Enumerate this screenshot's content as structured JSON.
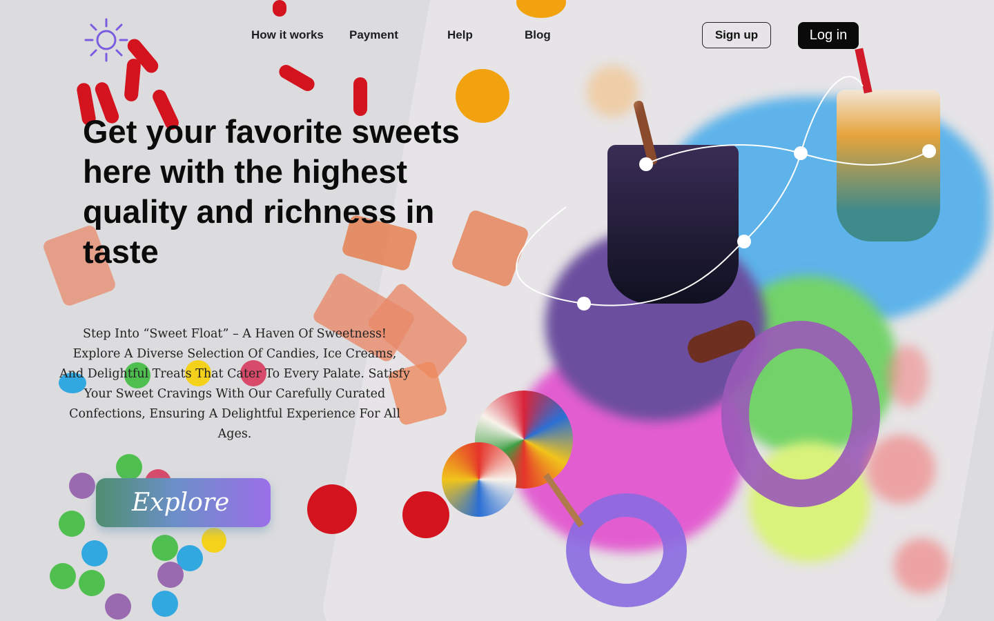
{
  "nav": {
    "how_it_works": "How it works",
    "payment": "Payment",
    "help": "Help",
    "blog": "Blog"
  },
  "auth": {
    "signup": "Sign up",
    "login": "Log in"
  },
  "hero": {
    "headline": "Get your favorite sweets here with the highest quality and richness in taste",
    "description": "Step Into “Sweet Float” – A Haven Of Sweetness! Explore A Diverse Selection Of Candies, Ice Creams, And Delightful Treats That Cater To Every Palate. Satisfy Your Sweet Cravings With Our Carefully Curated Confections, Ensuring A Delightful Experience For All Ages.",
    "cta": "Explore"
  },
  "colors": {
    "logo": "#7b5ce0",
    "blob_blue": "#5db3ea",
    "blob_purple": "#6b4e9e",
    "blob_pink": "#e25ed0",
    "blob_green": "#73d36a",
    "blob_yellow": "#d9f27a"
  }
}
